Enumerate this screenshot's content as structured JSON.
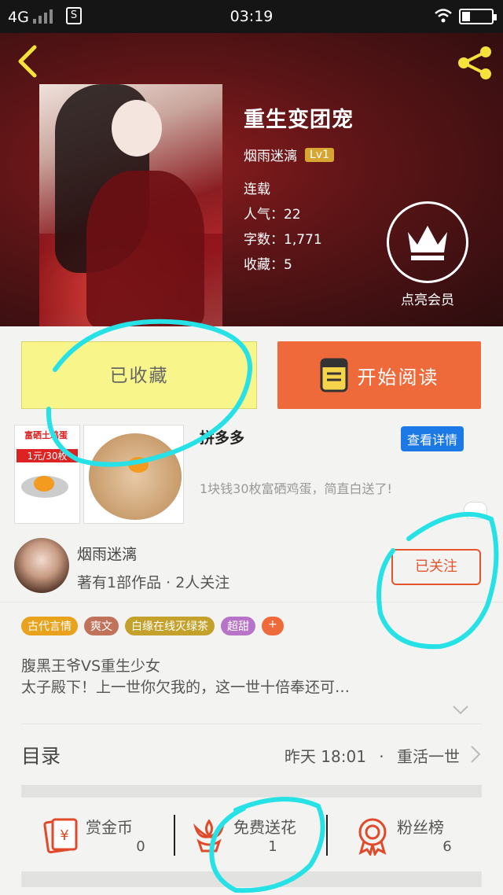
{
  "status_bar": {
    "network": "4G",
    "sim_icon": "S",
    "time": "03:19"
  },
  "book": {
    "title": "重生变团宠",
    "author": "烟雨迷漓",
    "level": "Lv1",
    "status": "连载",
    "popularity": "人气：22",
    "word_count": "字数：1,771",
    "collections": "收藏：5",
    "vip_label": "点亮会员"
  },
  "actions": {
    "favorite_label": "已收藏",
    "read_label": "开始阅读"
  },
  "ad": {
    "badge_top": "富硒土鸡蛋",
    "badge_price": "1元/30枚",
    "title": "拼多多",
    "detail_label": "查看详情",
    "description": "1块钱30枚富硒鸡蛋，简直白送了!"
  },
  "author_card": {
    "name": "烟雨迷漓",
    "stats": "著有1部作品 · 2人关注",
    "follow_label": "已关注"
  },
  "tags": [
    {
      "label": "古代言情",
      "color": "#e8a21c"
    },
    {
      "label": "爽文",
      "color": "#c0735a"
    },
    {
      "label": "白缘在线灭绿茶",
      "color": "#c4a12a"
    },
    {
      "label": "超甜",
      "color": "#b773c7"
    },
    {
      "label": "+",
      "color": "#ef6a3a"
    }
  ],
  "description": {
    "line1": "腹黑王爷VS重生少女",
    "line2": "太子殿下！上一世你欠我的，这一世十倍奉还可…"
  },
  "toc": {
    "label": "目录",
    "updated": "昨天 18:01",
    "separator": "·",
    "latest_chapter": "重活一世"
  },
  "stats": [
    {
      "label": "赏金币",
      "value": "0",
      "icon": "reward-coin-icon"
    },
    {
      "label": "免费送花",
      "value": "1",
      "icon": "flower-icon"
    },
    {
      "label": "粉丝榜",
      "value": "6",
      "icon": "medal-icon"
    }
  ],
  "colors": {
    "accent_orange": "#ef6a3a",
    "favorite_yellow": "#f8f58b",
    "annotation_cyan": "#26e1e6",
    "hero_red": "#5a1416"
  }
}
